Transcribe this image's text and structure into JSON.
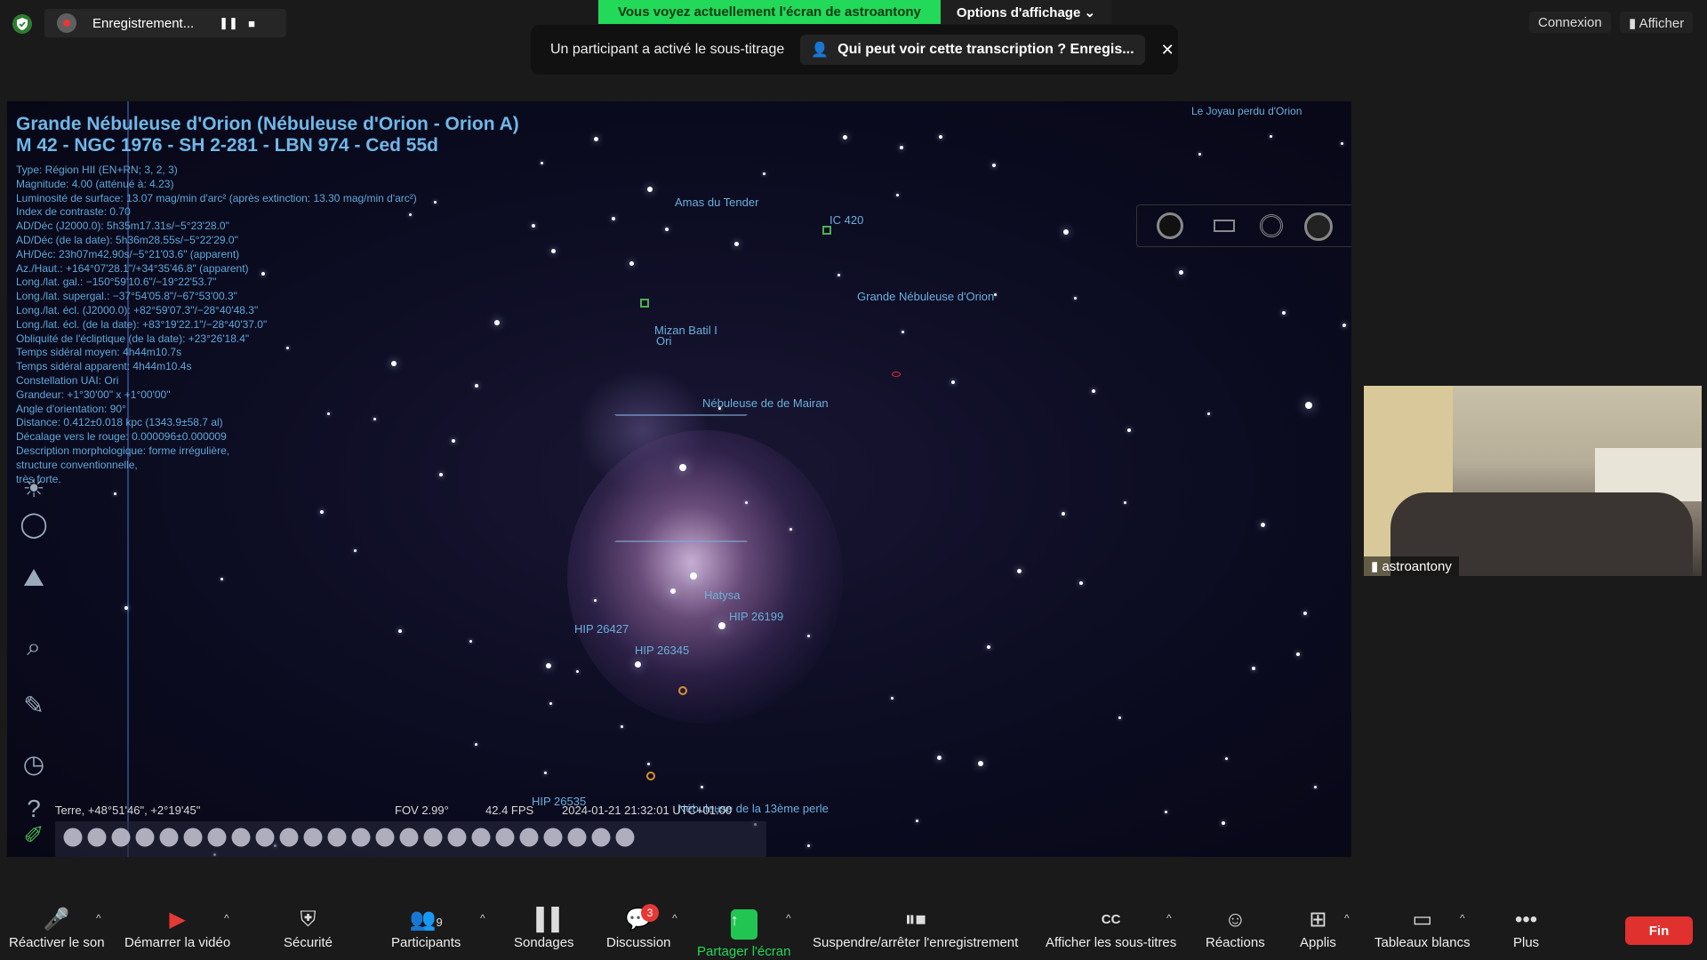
{
  "topbar": {
    "recording_label": "Enregistrement...",
    "pause_icon": "pause-icon",
    "stop_icon": "stop-icon",
    "share_notice": "Vous voyez actuellement l'écran de astroantony",
    "view_options": "Options d'affichage",
    "caption_notice": "Un participant a activé le sous-titrage",
    "caption_who": "Qui peut voir cette transcription ? Enregis...",
    "connexion": "Connexion",
    "afficher": "Afficher"
  },
  "stellarium": {
    "title_line1": "Grande Nébuleuse d'Orion (Nébuleuse d'Orion - Orion A)",
    "title_line2": "M 42 - NGC 1976 - SH 2-281 - LBN 974 - Ced 55d",
    "info_rows": [
      "Type: Région HII (EN+RN; 3, 2, 3)",
      "Magnitude: 4.00 (atténué à: 4.23)",
      "Luminosité de surface: 13.07 mag/min d'arc² (après extinction: 13.30 mag/min d'arc²)",
      "Index de contraste: 0.70",
      "AD/Déc (J2000.0): 5h35m17.31s/−5°23'28.0\"",
      "AD/Déc (de la date): 5h36m28.55s/−5°22'29.0\"",
      "AH/Déc: 23h07m42.90s/−5°21'03.6\" (apparent)",
      "Az./Haut.: +164°07'28.1\"/+34°35'46.8\" (apparent)",
      "Long./lat. gal.: −150°59'10.6\"/−19°22'53.7\"",
      "Long./lat. supergal.: −37°54'05.8\"/−67°53'00.3\"",
      "Long./lat. écl. (J2000.0): +82°59'07.3\"/−28°40'48.3\"",
      "Long./lat. écl. (de la date): +83°19'22.1\"/−28°40'37.0\"",
      "Obliquité de l'écliptique (de la date): +23°26'18.4\"",
      "Temps sidéral moyen: 4h44m10.7s",
      "Temps sidéral apparent: 4h44m10.4s",
      "Constellation UAI: Ori",
      "Grandeur: +1°30'00\" x +1°00'00\"",
      "Angle d'orientation: 90°",
      "Distance: 0.412±0.018 kpc (1343.9±58.7 al)",
      "Décalage vers le rouge: 0.000096±0.000009",
      "Description morphologique: forme irrégulière,",
      "structure conventionnelle,",
      "très forte."
    ],
    "labels": {
      "amas": "Amas du Tender",
      "ic420": "IC 420",
      "grande": "Grande Nébuleuse d'Orion",
      "mizan": "Mizan Batil I",
      "ori": "Ori",
      "mairan": "Nébuleuse de de Mairan",
      "hatysa": "Hatysa",
      "hip26199": "HIP 26199",
      "hip26427": "HIP 26427",
      "hip26345": "HIP 26345",
      "hip26535": "HIP 26535",
      "perle": "Nébuleuse de la 13ème perle",
      "joyau": "Le Joyau perdu d'Orion"
    },
    "status": {
      "location": "Terre, +48°51'46\", +2°19'45\"",
      "fov": "FOV 2.99°",
      "fps": "42.4 FPS",
      "datetime": "2024-01-21 21:32:01 UTC+01:00"
    }
  },
  "video": {
    "participant_name": "astroantony"
  },
  "bottombar": {
    "audio": "Réactiver le son",
    "video": "Démarrer la vidéo",
    "security": "Sécurité",
    "participants": "Participants",
    "participants_count": "9",
    "polls": "Sondages",
    "chat": "Discussion",
    "chat_badge": "3",
    "share": "Partager l'écran",
    "record": "Suspendre/arrêter l'enregistrement",
    "captions": "Afficher les sous-titres",
    "reactions": "Réactions",
    "apps": "Applis",
    "whiteboards": "Tableaux blancs",
    "more": "Plus",
    "end": "Fin"
  },
  "colors": {
    "share_green": "#23d959",
    "end_red": "#e0312f",
    "info_blue": "#5fa8d8"
  }
}
